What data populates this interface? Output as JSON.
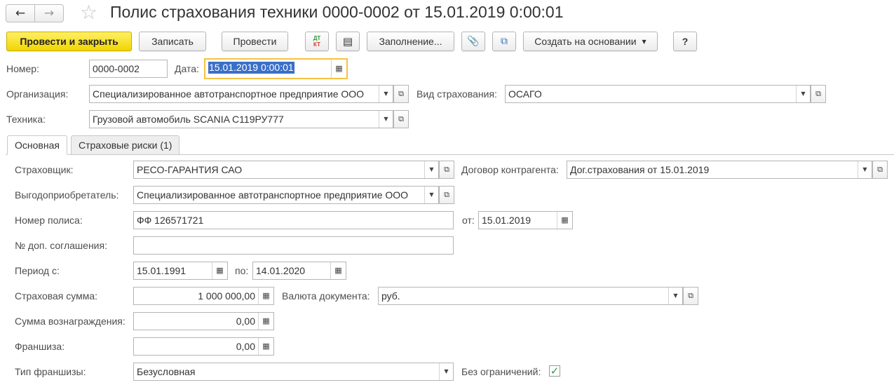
{
  "header": {
    "title": "Полис страхования техники 0000-0002 от 15.01.2019 0:00:01"
  },
  "toolbar": {
    "post_close": "Провести и закрыть",
    "save": "Записать",
    "post": "Провести",
    "dtkt_top": "ДТ",
    "dtkt_bottom": "КТ",
    "fill": "Заполнение...",
    "create_based_on": "Создать на основании",
    "help": "?"
  },
  "form": {
    "number_label": "Номер:",
    "number_value": "0000-0002",
    "date_label": "Дата:",
    "date_value": "15.01.2019  0:00:01",
    "org_label": "Организация:",
    "org_value": "Специализированное автотранспортное предприятие ООО",
    "ins_type_label": "Вид страхования:",
    "ins_type_value": "ОСАГО",
    "equipment_label": "Техника:",
    "equipment_value": "Грузовой автомобиль SCANIA С119РУ777"
  },
  "tabs": [
    {
      "label": "Основная",
      "active": true
    },
    {
      "label": "Страховые риски (1)",
      "active": false
    }
  ],
  "main": {
    "insurer_label": "Страховщик:",
    "insurer_value": "РЕСО-ГАРАНТИЯ САО",
    "contract_label": "Договор контрагента:",
    "contract_value": "Дог.страхования от 15.01.2019",
    "beneficiary_label": "Выгодоприобретатель:",
    "beneficiary_value": "Специализированное автотранспортное предприятие ООО",
    "policy_no_label": "Номер полиса:",
    "policy_no_value": "ФФ 126571721",
    "from_label": "от:",
    "from_value": "15.01.2019",
    "addendum_label": "№ доп. соглашения:",
    "addendum_value": "",
    "period_label": "Период с:",
    "period_from": "15.01.1991",
    "period_to_label": "по:",
    "period_to": "14.01.2020",
    "sum_label": "Страховая сумма:",
    "sum_value": "1 000 000,00",
    "currency_label": "Валюта документа:",
    "currency_value": "руб.",
    "reward_label": "Сумма вознаграждения:",
    "reward_value": "0,00",
    "deductible_label": "Франшиза:",
    "deductible_value": "0,00",
    "deductible_type_label": "Тип франшизы:",
    "deductible_type_value": "Безусловная",
    "unlimited_label": "Без ограничений:",
    "unlimited_checked": true
  }
}
